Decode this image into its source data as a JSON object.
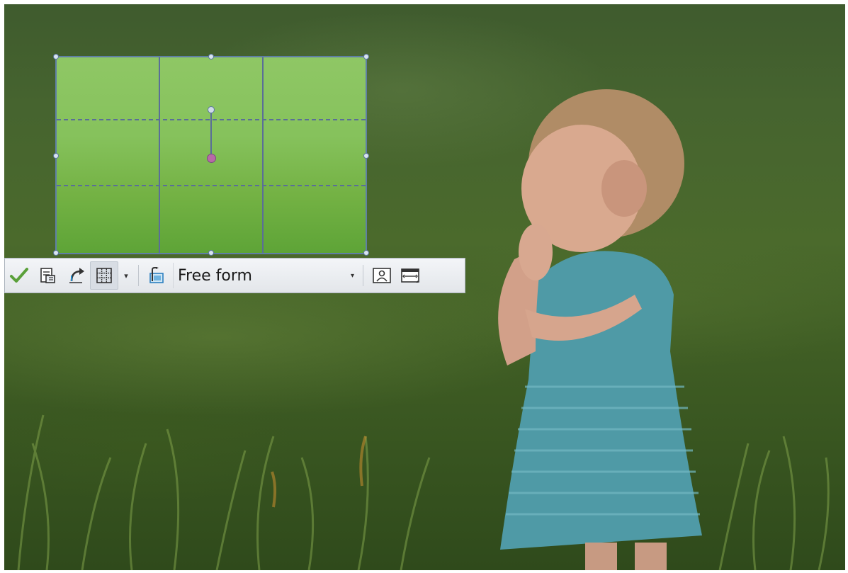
{
  "colors": {
    "crop_border": "#5f7fa6",
    "grid_line": "#5a6e98",
    "rotation_center": "#b86aa6",
    "toolbar_bg": "#e6e9ed",
    "confirm_check": "#5aa03a"
  },
  "toolbar": {
    "items": [
      {
        "name": "confirm-crop-button",
        "icon": "checkmark-icon"
      },
      {
        "name": "crop-save-button",
        "icon": "document-crop-icon"
      },
      {
        "name": "rotate-button",
        "icon": "rotate-icon"
      },
      {
        "name": "grid-overlay-button",
        "icon": "grid-icon"
      },
      {
        "name": "grid-options-dropdown",
        "icon": "chevron-down-icon"
      },
      {
        "name": "aspect-preset-button",
        "icon": "ratio-icon"
      },
      {
        "name": "portrait-button",
        "icon": "person-portrait-icon"
      },
      {
        "name": "landscape-button",
        "icon": "landscape-frame-icon"
      }
    ],
    "aspect_select": {
      "value": "Free form"
    }
  }
}
